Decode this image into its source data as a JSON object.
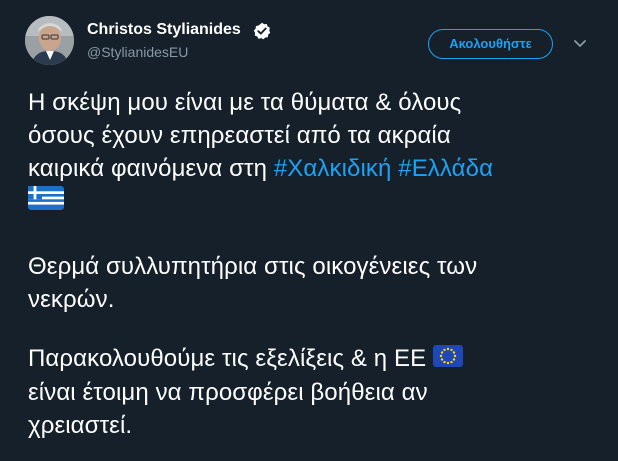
{
  "author": {
    "name": "Christos Stylianides",
    "handle": "@StylianidesEU",
    "verified_icon": "verified-badge-icon"
  },
  "follow_button": {
    "label": "Ακολουθήστε"
  },
  "menu": {
    "icon": "chevron-down-icon"
  },
  "tweet": {
    "p1": {
      "line1": "Η σκέψη μου είναι με τα θύματα & όλους",
      "line2": "όσους έχουν επηρεαστεί από τα ακραία",
      "line3_text": "καιρικά φαινόμενα στη ",
      "hashtag1": "#Χαλκιδική",
      "hashtag2": "#Ελλάδα",
      "emoji": "greek-flag-emoji"
    },
    "p2": {
      "line1": "Θερμά συλλυπητήρια στις οικογένειες των",
      "line2": "νεκρών."
    },
    "p3": {
      "line1_text": "Παρακολουθούμε τις εξελίξεις & η ΕΕ",
      "emoji": "eu-flag-emoji",
      "line2": "είναι έτοιμη να προσφέρει βοήθεια αν",
      "line3": "χρειαστεί."
    }
  },
  "colors": {
    "background": "#15202b",
    "accent": "#1da1f2",
    "secondary_text": "#8899a6",
    "text": "#ffffff"
  }
}
